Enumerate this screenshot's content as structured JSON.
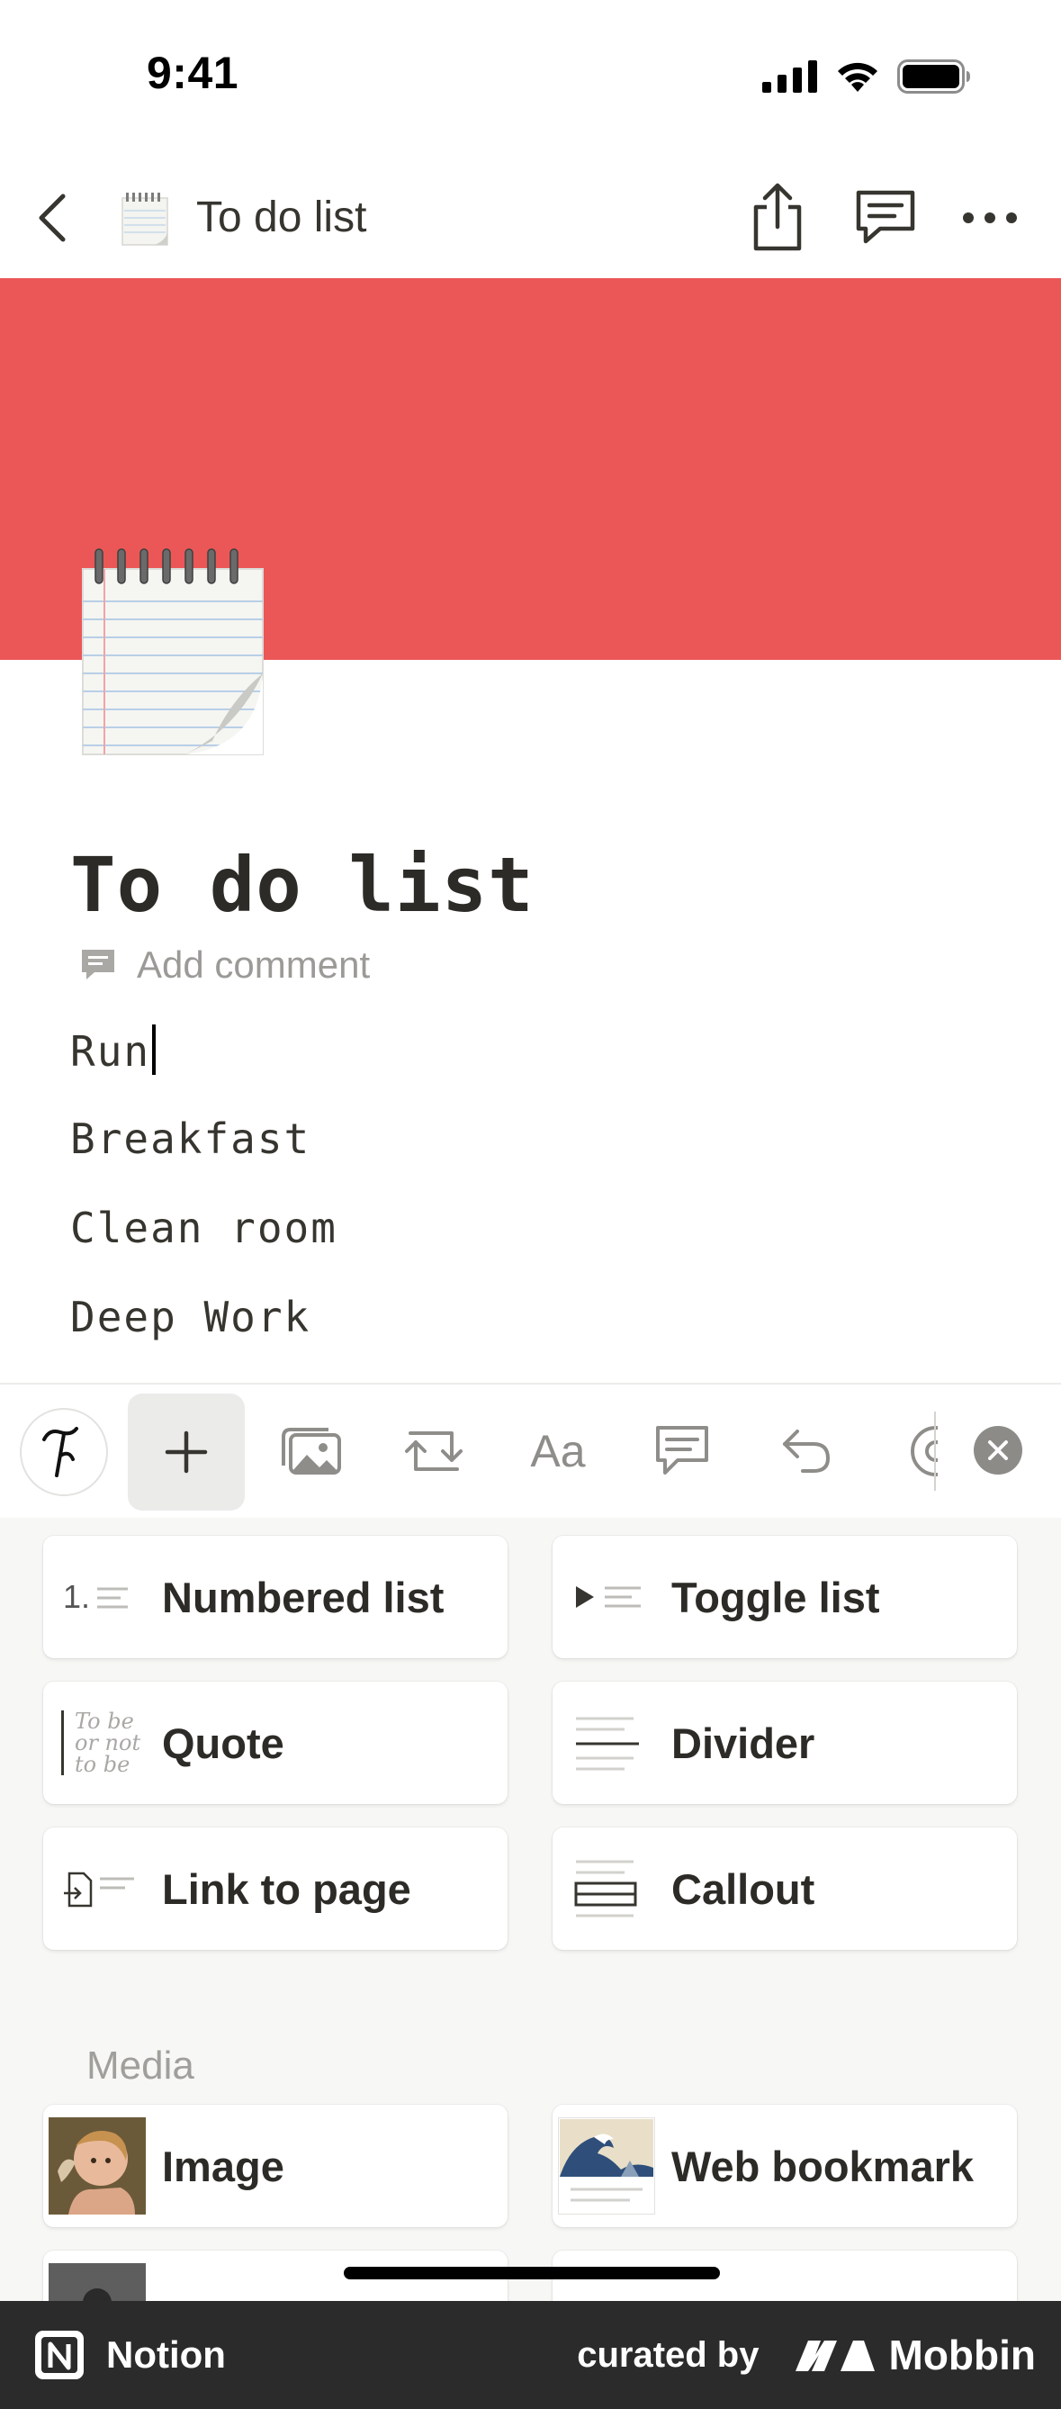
{
  "status_bar": {
    "time": "9:41"
  },
  "nav": {
    "title": "To do list"
  },
  "page": {
    "title": "To do list",
    "add_comment": "Add comment",
    "items": [
      "Run",
      "Breakfast",
      "Clean room",
      "Deep Work"
    ]
  },
  "colors": {
    "cover": "#eb5757",
    "footer": "#2b2b2b"
  },
  "toolbar": {
    "icons": [
      "ai-icon",
      "plus-icon",
      "media-icon",
      "turn-into-icon",
      "text-style-icon",
      "comment-icon",
      "undo-icon",
      "mention-icon",
      "close-icon"
    ],
    "text_style_label": "Aa"
  },
  "menu": {
    "blocks": [
      {
        "label": "Numbered list",
        "thumb": "1."
      },
      {
        "label": "Toggle list"
      },
      {
        "label": "Quote",
        "thumb_lines": [
          "To be",
          "or not",
          "to be"
        ]
      },
      {
        "label": "Divider"
      },
      {
        "label": "Link to page"
      },
      {
        "label": "Callout"
      }
    ],
    "media_section": "Media",
    "media": [
      {
        "label": "Image"
      },
      {
        "label": "Web bookmark"
      }
    ]
  },
  "footer": {
    "app_name": "Notion",
    "curated_by": "curated by",
    "brand": "Mobbin"
  }
}
